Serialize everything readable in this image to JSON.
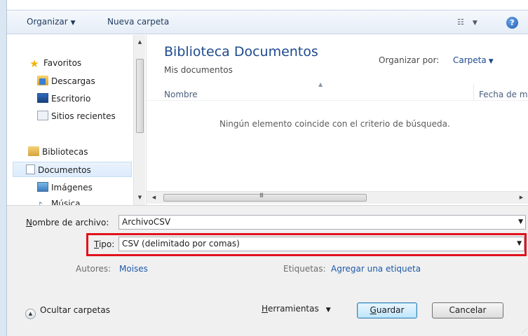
{
  "toolbar": {
    "organize_label": "Organizar",
    "new_folder_label": "Nueva carpeta",
    "help_label": "?"
  },
  "nav": {
    "favorites": {
      "label": "Favoritos",
      "items": [
        {
          "label": "Descargas"
        },
        {
          "label": "Escritorio"
        },
        {
          "label": "Sitios recientes"
        }
      ]
    },
    "libraries": {
      "label": "Bibliotecas",
      "items": [
        {
          "label": "Documentos",
          "selected": true
        },
        {
          "label": "Imágenes"
        },
        {
          "label": "Música"
        }
      ]
    }
  },
  "content": {
    "library_title": "Biblioteca Documentos",
    "library_subtitle": "Mis documentos",
    "arrange_by_label": "Organizar por:",
    "arrange_by_value": "Carpeta",
    "columns": {
      "name": "Nombre",
      "date": "Fecha de m"
    },
    "empty_message": "Ningún elemento coincide con el criterio de búsqueda."
  },
  "form": {
    "filename": {
      "label_prefix": "N",
      "label_rest": "ombre de archivo:",
      "value": "ArchivoCSV"
    },
    "filetype": {
      "label_prefix": "T",
      "label_rest": "ipo:",
      "value": "CSV (delimitado por comas)"
    },
    "authors": {
      "label": "Autores:",
      "value": "Moises"
    },
    "tags": {
      "label": "Etiquetas:",
      "value": "Agregar una etiqueta"
    }
  },
  "footer": {
    "hide_folders_label": "Ocultar carpetas",
    "tools_prefix": "H",
    "tools_rest": "erramientas",
    "save_prefix": "G",
    "save_rest": "uardar",
    "cancel_label": "Cancelar"
  },
  "colors": {
    "highlight": "#e0121b",
    "link": "#1e5aa8",
    "title": "#1e4a8e"
  }
}
